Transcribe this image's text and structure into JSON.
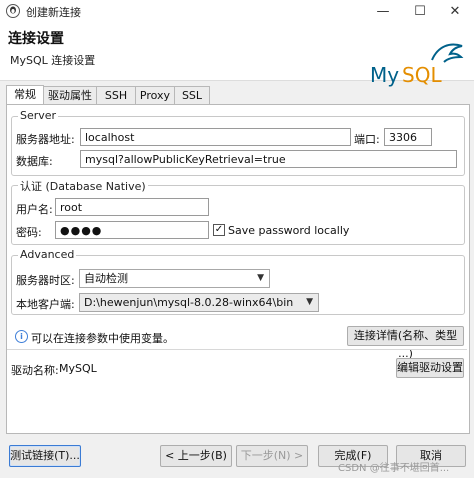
{
  "window": {
    "title": "创建新连接",
    "minimize_icon": "minimize-icon",
    "maximize_icon": "maximize-icon",
    "close_icon": "close-icon"
  },
  "header": {
    "title": "连接设置",
    "subtitle": "MySQL 连接设置",
    "logo_text": "MySQL"
  },
  "tabs": [
    {
      "label": "常规",
      "active": true
    },
    {
      "label": "驱动属性",
      "active": false
    },
    {
      "label": "SSH",
      "active": false
    },
    {
      "label": "Proxy",
      "active": false
    },
    {
      "label": "SSL",
      "active": false
    }
  ],
  "server": {
    "legend": "Server",
    "host_label": "服务器地址:",
    "host_value": "localhost",
    "port_label": "端口:",
    "port_value": "3306",
    "database_label": "数据库:",
    "database_value": "mysql?allowPublicKeyRetrieval=true"
  },
  "auth": {
    "legend": "认证 (Database Native)",
    "user_label": "用户名:",
    "user_value": "root",
    "password_label": "密码:",
    "password_value": "●●●●",
    "save_password_label": "Save password locally",
    "save_password_checked": true,
    "check_mark": "✓"
  },
  "advanced": {
    "legend": "Advanced",
    "timezone_label": "服务器时区:",
    "timezone_value": "自动检测",
    "client_label": "本地客户端:",
    "client_value": "D:\\hewenjun\\mysql-8.0.28-winx64\\bin"
  },
  "info": {
    "text": "可以在连接参数中使用变量。",
    "details_button": "连接详情(名称、类型 ...)"
  },
  "driver": {
    "label": "驱动名称:",
    "value": "MySQL",
    "edit_button": "编辑驱动设置"
  },
  "footer": {
    "test_button": "测试链接(T)...",
    "back_button": "< 上一步(B)",
    "next_button": "下一步(N) >",
    "finish_button": "完成(F)",
    "cancel_button": "取消",
    "watermark": "CSDN @往事不堪回首..."
  },
  "colors": {
    "mysql_blue": "#00618a",
    "mysql_orange": "#e48e00",
    "focus_blue": "#3b7bd4"
  }
}
